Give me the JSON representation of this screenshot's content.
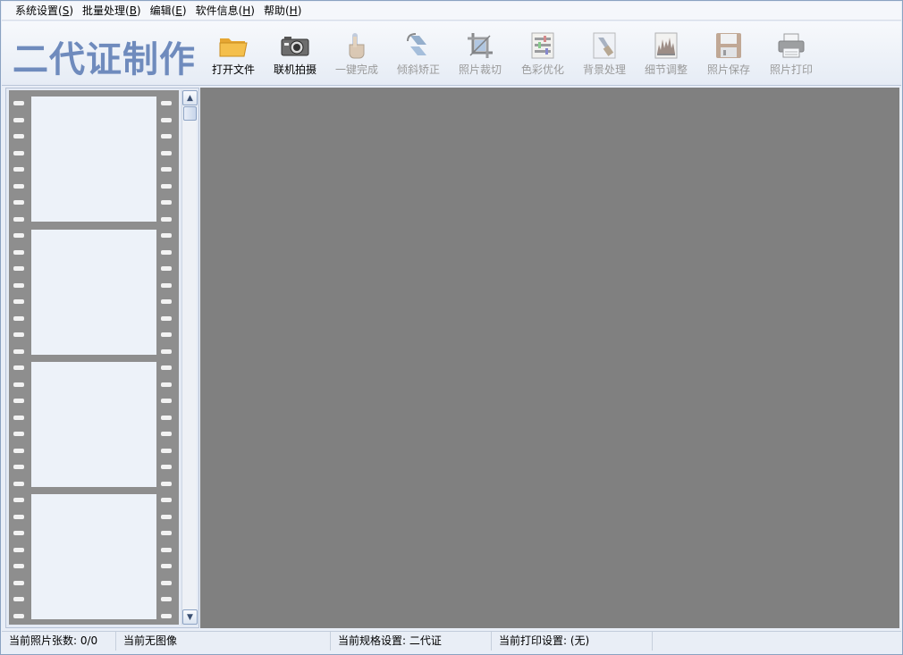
{
  "menu": [
    {
      "text": "系统设置(",
      "key": "S",
      "end": ")"
    },
    {
      "text": "批量处理(",
      "key": "B",
      "end": ")"
    },
    {
      "text": "编辑(",
      "key": "E",
      "end": ")"
    },
    {
      "text": "软件信息(",
      "key": "H",
      "end": ")"
    },
    {
      "text": "帮助(",
      "key": "H",
      "end": ")"
    }
  ],
  "brand": "二代证制作",
  "toolbar": {
    "open_file": "打开文件",
    "capture": "联机拍摄",
    "one_click": "一键完成",
    "deskew": "倾斜矫正",
    "crop": "照片裁切",
    "color": "色彩优化",
    "background": "背景处理",
    "detail": "细节调整",
    "save": "照片保存",
    "print": "照片打印"
  },
  "icons": {
    "open_file": "folder-icon",
    "capture": "camera-icon",
    "one_click": "hand-pointer-icon",
    "deskew": "rotate-icon",
    "crop": "crop-icon",
    "color": "color-bars-icon",
    "background": "brush-icon",
    "detail": "histogram-icon",
    "save": "floppy-icon",
    "print": "printer-icon"
  },
  "status": {
    "count": "当前照片张数: 0/0",
    "image": "当前无图像",
    "spec": "当前规格设置: 二代证",
    "print": "当前打印设置: (无)"
  },
  "colors": {
    "brand": "#6f8bbd",
    "workspace": "#808080",
    "film": "#8e8e8e"
  }
}
